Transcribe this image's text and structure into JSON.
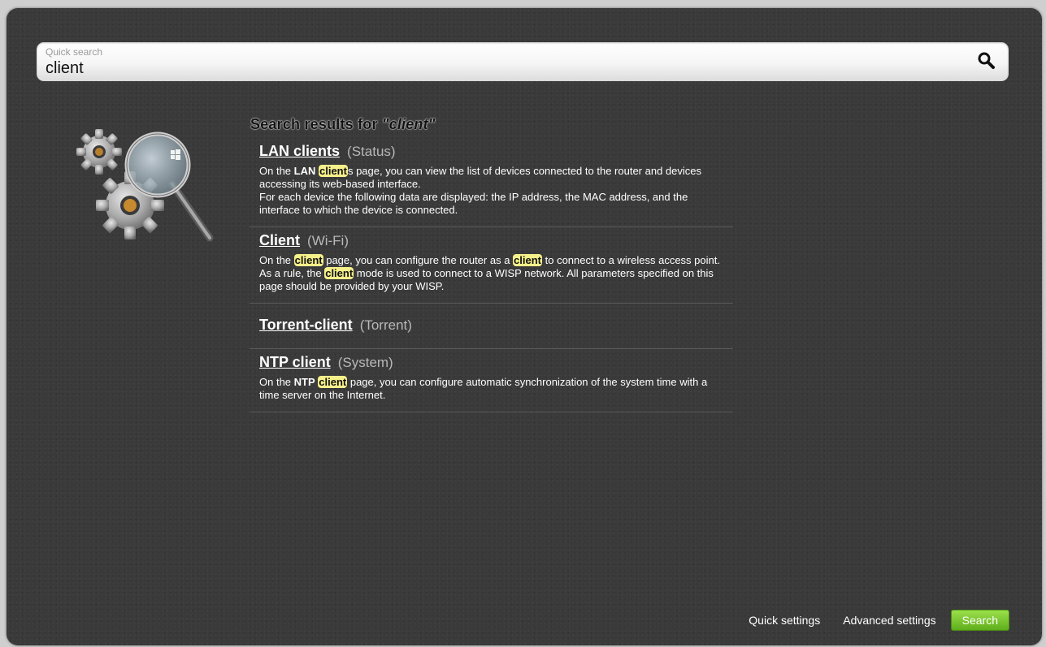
{
  "search": {
    "caption": "Quick search",
    "value": "client",
    "icon": "search-icon"
  },
  "results_heading": {
    "prefix": "Search results for ",
    "query": "\"client\""
  },
  "results": [
    {
      "title": "LAN clients",
      "category": "(Status)",
      "description": {
        "p1_a": "On the ",
        "p1_b": "LAN",
        "p1_hl": "client",
        "p1_c": "s page, you can view the list of devices connected to the router and devices accessing its web-based interface.",
        "p2": "For each device the following data are displayed: the IP address, the MAC address, and the interface to which the device is connected."
      }
    },
    {
      "title": "Client",
      "category": "(Wi-Fi)",
      "description": {
        "p1_a": "On the ",
        "p1_hl1": "client",
        "p1_b": " page, you can configure the router as a ",
        "p1_hl2": "client",
        "p1_c": " to connect to a wireless access point.",
        "p2_a": "As a rule, the ",
        "p2_hl": "client",
        "p2_b": " mode is used to connect to a WISP network. All parameters specified on this page should be provided by your WISP."
      }
    },
    {
      "title": "Torrent-client",
      "category": "(Torrent)"
    },
    {
      "title": "NTP client",
      "category": "(System)",
      "description": {
        "p1_a": "On the ",
        "p1_b": "NTP",
        "p1_hl": "client",
        "p1_c": " page, you can configure automatic synchronization of the system time with a time server on the Internet."
      }
    }
  ],
  "footer": {
    "quick_settings": "Quick settings",
    "advanced_settings": "Advanced settings",
    "search_button": "Search"
  },
  "colors": {
    "background": "#3a3a3a",
    "highlight": "#f6f08a",
    "button": "#7cc832"
  },
  "illustration": "gears-magnifier-icon"
}
